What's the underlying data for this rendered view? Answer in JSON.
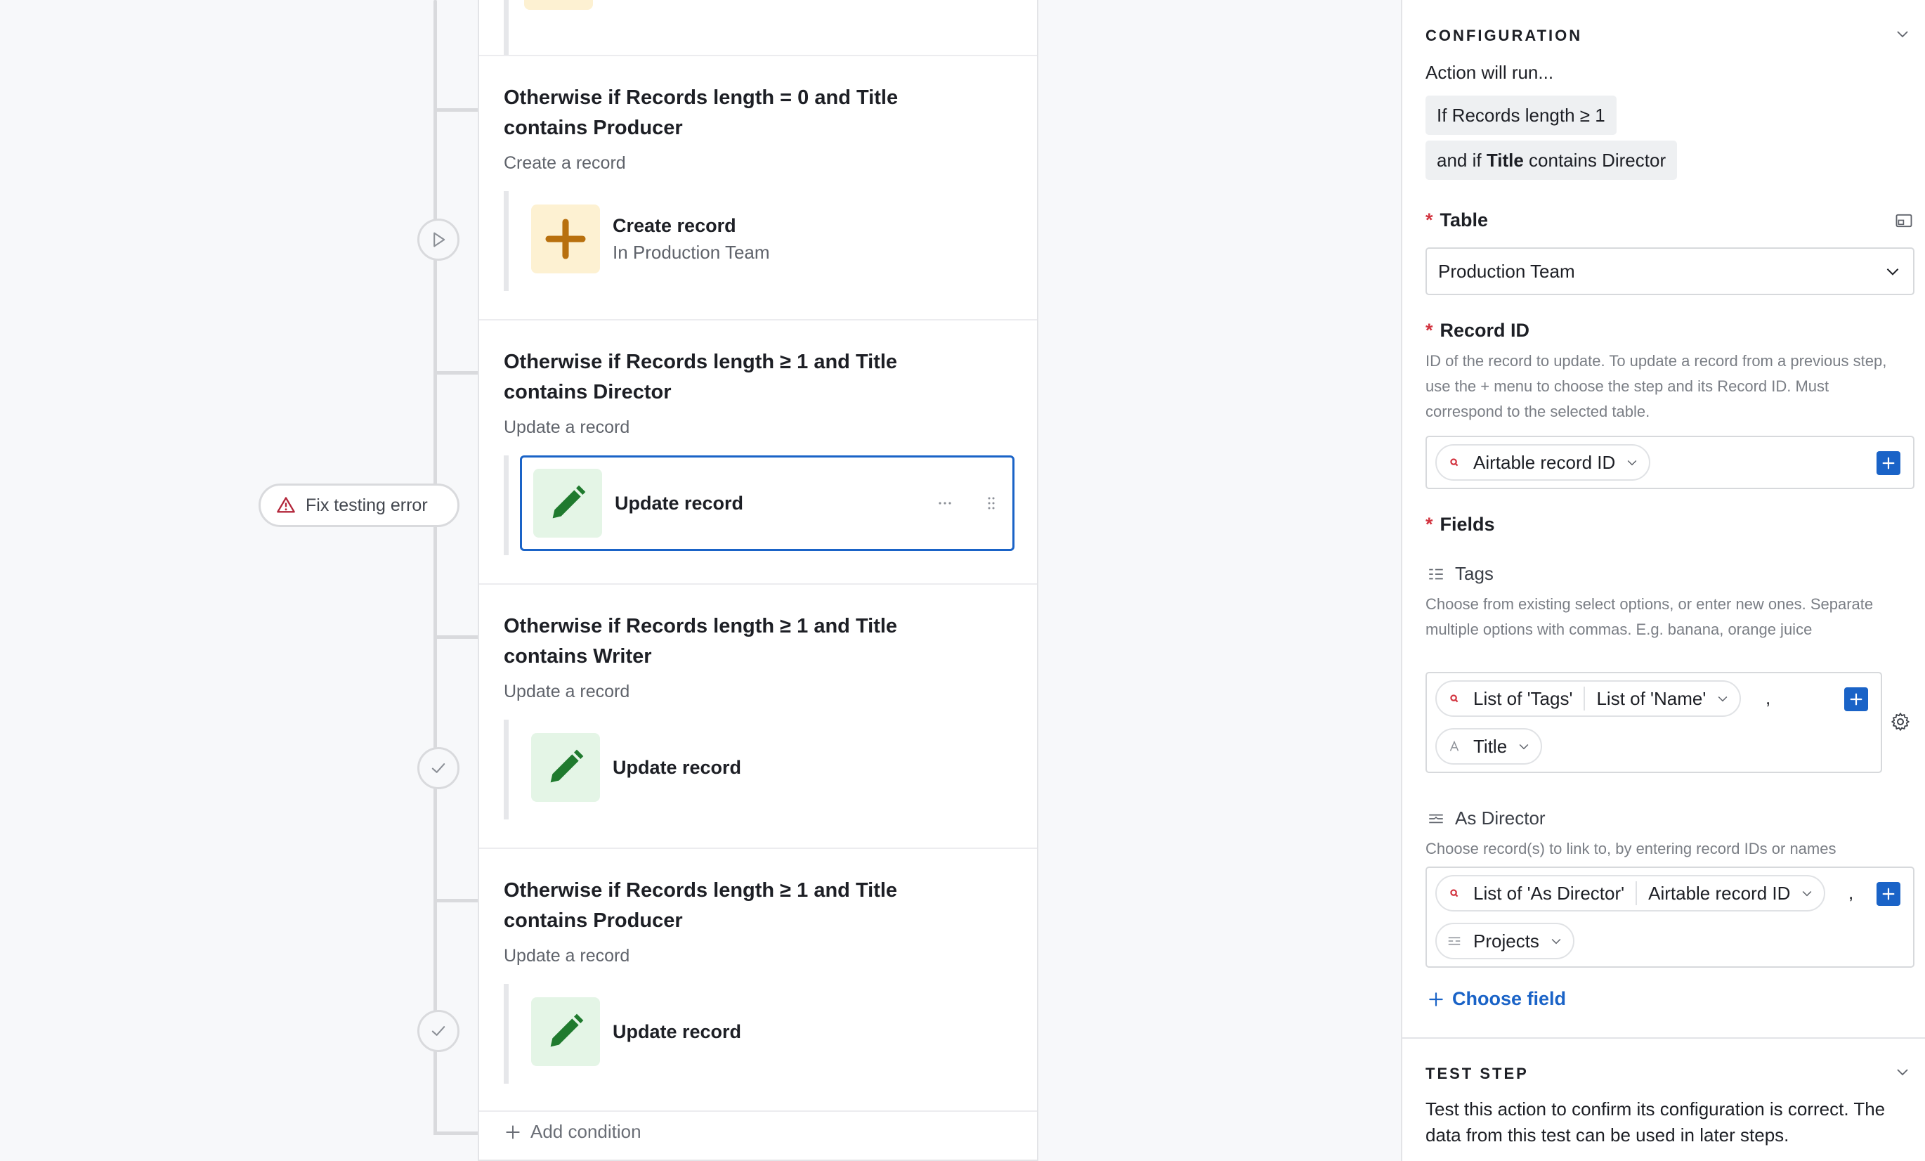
{
  "flow": {
    "error_button": "Fix testing error",
    "add_condition": "Add condition",
    "conditions": [
      {
        "title": "Otherwise if Records length = 0 and Title contains Producer",
        "subtitle": "Create a record",
        "action_name": "Create record",
        "action_detail": "In Production Team",
        "icon": "plus-icon",
        "status": "play-icon"
      },
      {
        "title": "Otherwise if Records length ≥ 1 and Title contains Director",
        "subtitle": "Update a record",
        "action_name": "Update record",
        "action_detail": "",
        "icon": "pencil-icon",
        "status": "error",
        "selected": true
      },
      {
        "title": "Otherwise if Records length ≥ 1 and Title contains Writer",
        "subtitle": "Update a record",
        "action_name": "Update record",
        "action_detail": "",
        "icon": "pencil-icon",
        "status": "check-icon"
      },
      {
        "title": "Otherwise if Records length ≥ 1 and Title contains Producer",
        "subtitle": "Update a record",
        "action_name": "Update record",
        "action_detail": "",
        "icon": "pencil-icon",
        "status": "check-icon"
      }
    ]
  },
  "panel": {
    "configuration": {
      "heading": "CONFIGURATION",
      "intro": "Action will run...",
      "chip1": "If Records length ≥ 1",
      "chip2_prefix": "and if ",
      "chip2_bold": "Title",
      "chip2_suffix": " contains Director"
    },
    "table": {
      "label": "Table",
      "value": "Production Team"
    },
    "record_id": {
      "label": "Record ID",
      "help": "ID of the record to update. To update a record from a previous step, use the + menu to choose the step and its Record ID. Must correspond to the selected table.",
      "token": "Airtable record ID"
    },
    "fields": {
      "label": "Fields",
      "tags": {
        "label": "Tags",
        "help": "Choose from existing select options, or enter new ones. Separate multiple options with commas. E.g. banana, orange juice",
        "token1_a": "List of 'Tags'",
        "token1_b": "List of 'Name'",
        "comma": ",",
        "token2": "Title"
      },
      "as_director": {
        "label": "As Director",
        "help": "Choose record(s) to link to, by entering record IDs or names",
        "token1_a": "List of 'As Director'",
        "token1_b": "Airtable record ID",
        "comma": ",",
        "token2": "Projects"
      },
      "choose_field": "Choose field"
    },
    "test_step": {
      "heading": "TEST STEP",
      "text": "Test this action to confirm its configuration is correct. The data from this test can be used in later steps."
    }
  },
  "colors": {
    "accent": "#1a63c7",
    "required": "#d2333f",
    "error": "#b3263a",
    "create_icon": "#b8700e",
    "update_icon": "#1f7a2e"
  }
}
